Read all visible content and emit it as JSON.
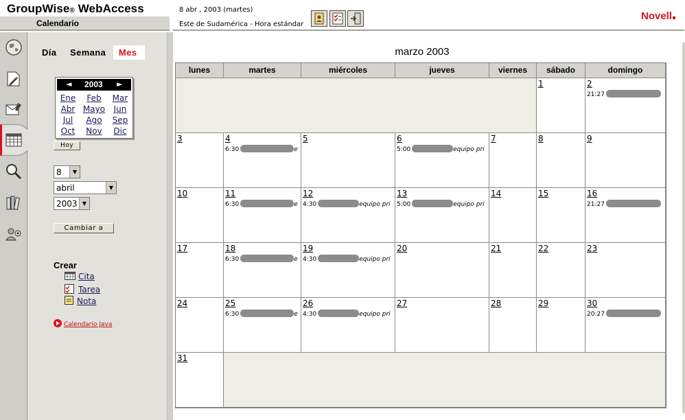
{
  "header": {
    "app_title": "GroupWise",
    "app_title_reg": "®",
    "app_title_suffix": "WebAccess",
    "subtitle": "Calendario",
    "date": "8 abr , 2003 (martes)",
    "timezone": "Este de Sudamérica - Hora estándar",
    "brand": "Novell",
    "toolbar_icons": [
      "address-book-icon",
      "checklist-icon",
      "exit-door-icon"
    ]
  },
  "rail": {
    "items": [
      "home-globe-icon",
      "compose-note-icon",
      "mailbox-icon",
      "calendar-icon",
      "search-icon",
      "library-books-icon",
      "users-options-icon"
    ]
  },
  "views": {
    "day": "Día",
    "week": "Semana",
    "month": "Mes"
  },
  "mini_year": {
    "year": "2003",
    "prev": "◄",
    "next": "►",
    "months": [
      "Ene",
      "Feb",
      "Mar",
      "Abr",
      "Mayo",
      "Jun",
      "Jul",
      "Ago",
      "Sep",
      "Oct",
      "Nov",
      "Dic"
    ],
    "today_button": "Hoy"
  },
  "goto": {
    "day": "8",
    "month": "abril",
    "year": "2003",
    "change_button": "Cambiar a"
  },
  "create": {
    "heading": "Crear",
    "items": [
      "Cita",
      "Tarea",
      "Nota"
    ]
  },
  "java_link": "Calendario Java",
  "calendar": {
    "title": "marzo 2003",
    "weekdays": [
      "lunes",
      "martes",
      "miércoles",
      "jueves",
      "viernes",
      "sábado",
      "domingo"
    ],
    "weeks": [
      [
        null,
        null,
        null,
        null,
        null,
        {
          "d": "1"
        },
        {
          "d": "2",
          "t": "21:27"
        }
      ],
      [
        {
          "d": "3"
        },
        {
          "d": "4",
          "t": "6:30",
          "tail": "e"
        },
        {
          "d": "5"
        },
        {
          "d": "6",
          "t": "5:00",
          "tail": "equipo pri"
        },
        {
          "d": "7"
        },
        {
          "d": "8"
        },
        {
          "d": "9"
        }
      ],
      [
        {
          "d": "10"
        },
        {
          "d": "11",
          "t": "6:30",
          "tail": "e"
        },
        {
          "d": "12",
          "t": "4:30",
          "tail": "equipo pri"
        },
        {
          "d": "13",
          "t": "5:00",
          "tail": "equipo pri"
        },
        {
          "d": "14"
        },
        {
          "d": "15"
        },
        {
          "d": "16",
          "t": "21:27"
        }
      ],
      [
        {
          "d": "17"
        },
        {
          "d": "18",
          "t": "6:30",
          "tail": "e"
        },
        {
          "d": "19",
          "t": "4:30",
          "tail": "equipo pri"
        },
        {
          "d": "20"
        },
        {
          "d": "21"
        },
        {
          "d": "22"
        },
        {
          "d": "23"
        }
      ],
      [
        {
          "d": "24"
        },
        {
          "d": "25",
          "t": "6:30",
          "tail": "e"
        },
        {
          "d": "26",
          "t": "4:30",
          "tail": "equipo pri"
        },
        {
          "d": "27"
        },
        {
          "d": "28"
        },
        {
          "d": "29"
        },
        {
          "d": "30",
          "t": "20:27"
        }
      ],
      [
        {
          "d": "31"
        },
        null,
        null,
        null,
        null,
        null,
        null
      ]
    ]
  },
  "colors": {
    "brand_red": "#d7131b",
    "panel": "#e2e1db",
    "empty_cell": "#efeee6",
    "header_cell": "#d4d3cd"
  }
}
